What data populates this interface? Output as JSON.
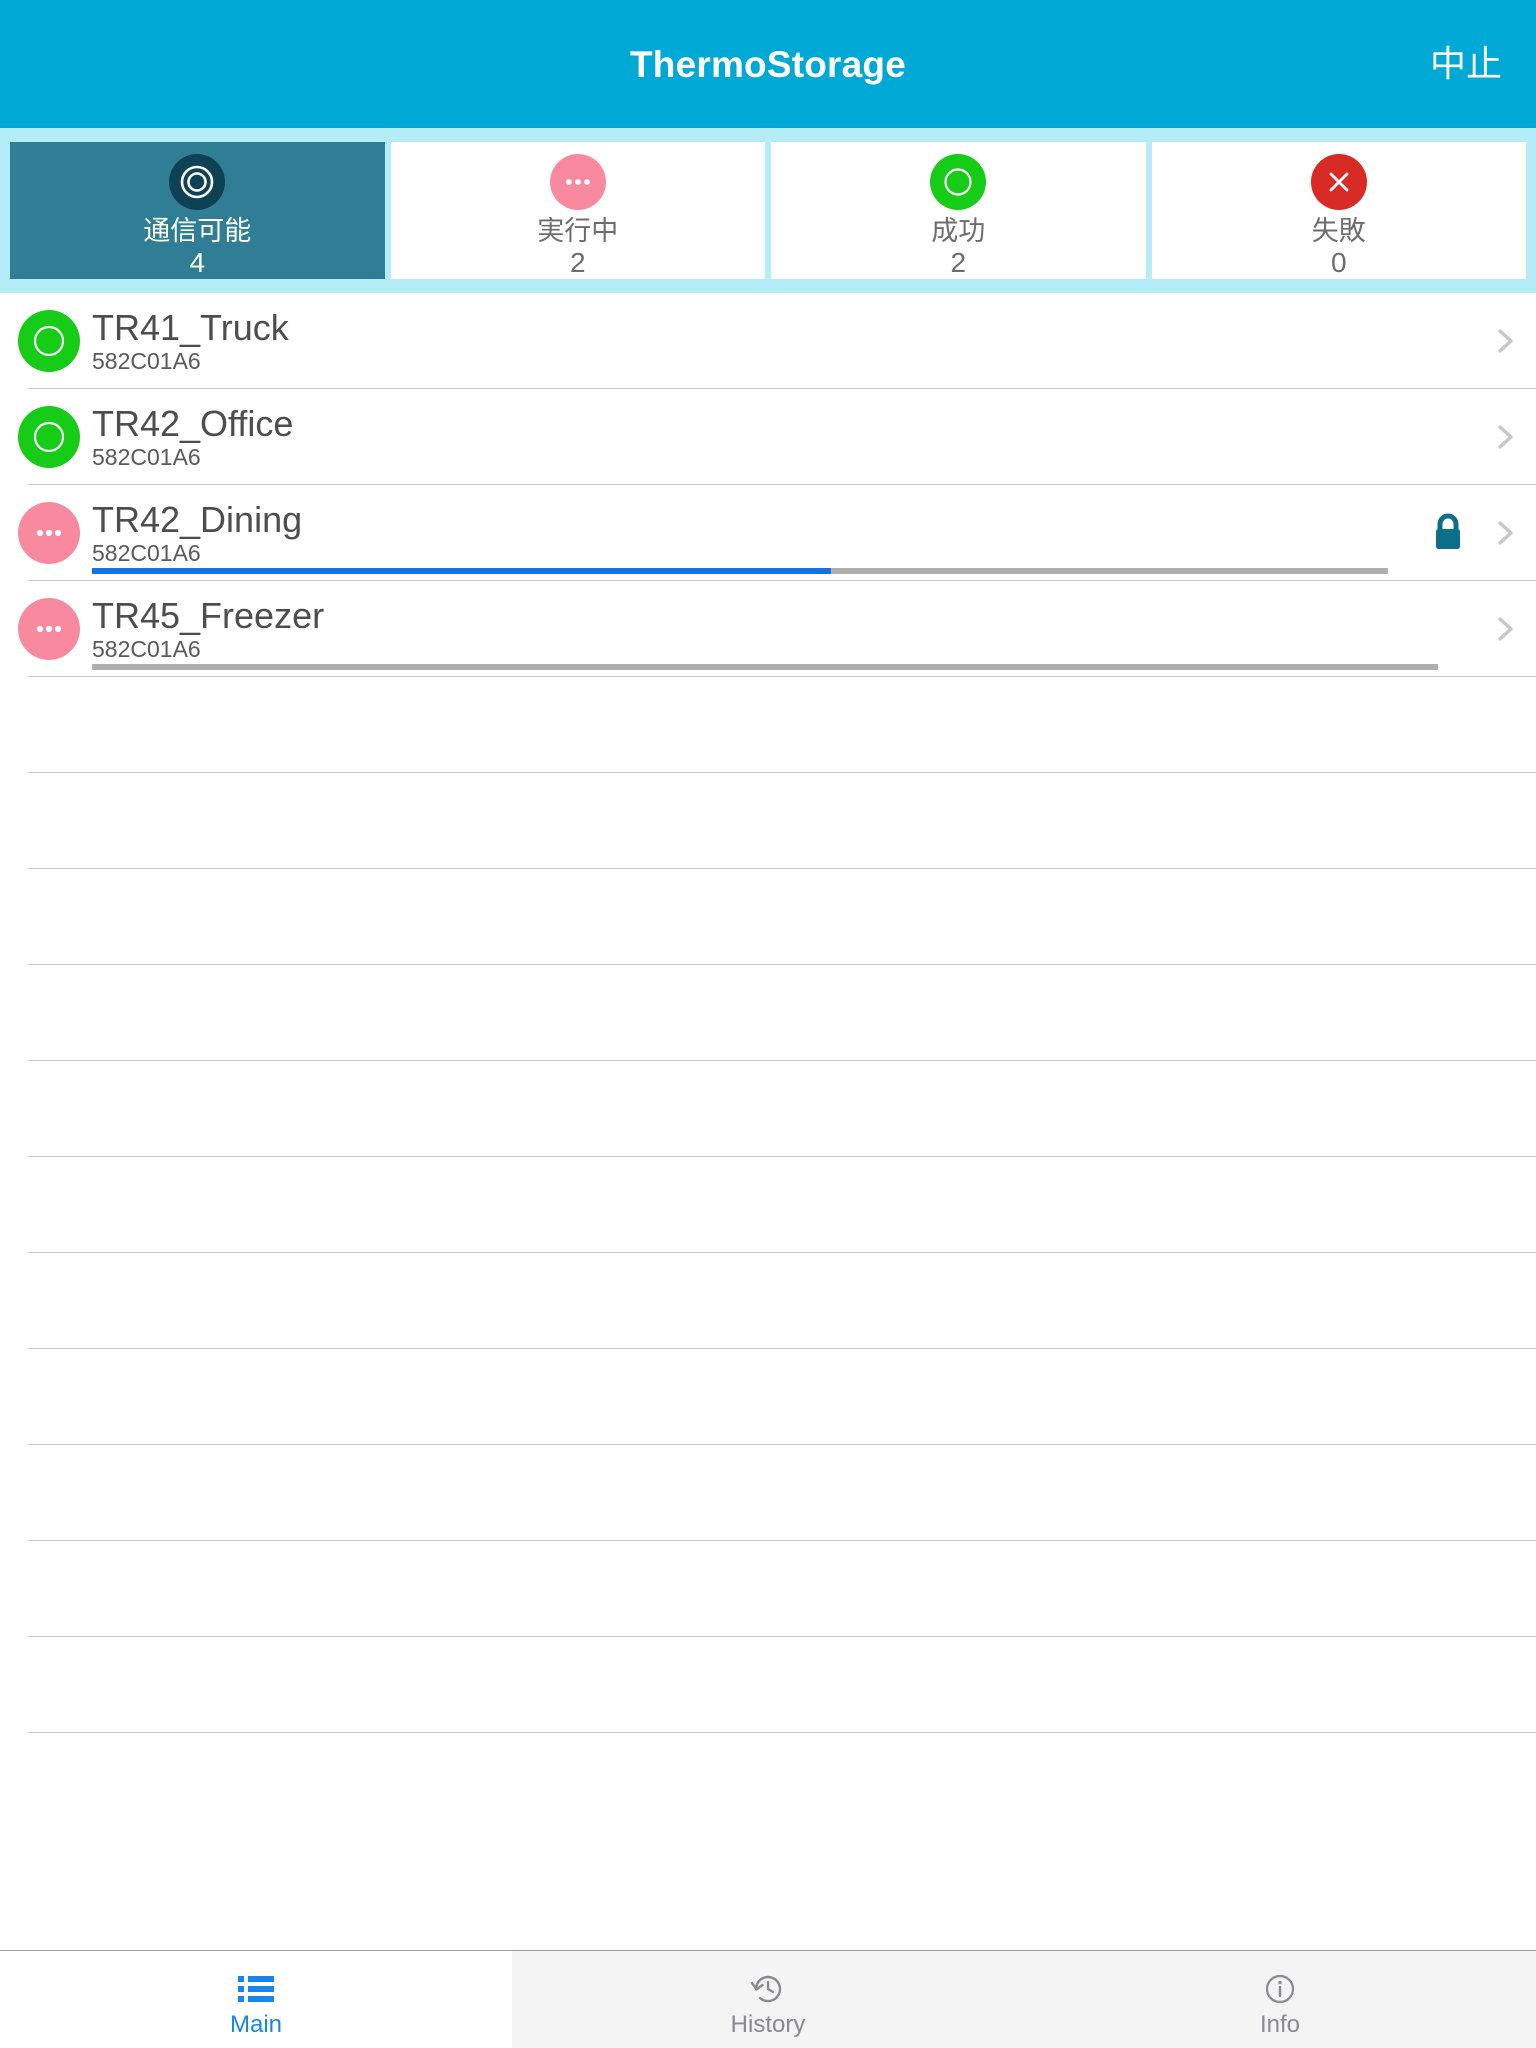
{
  "navbar": {
    "title": "ThermoStorage",
    "action_label": "中止",
    "background": "#00a8d5"
  },
  "status_tabs": {
    "background": "#b4ecf7",
    "items": [
      {
        "icon": "target-circle-icon",
        "label": "通信可能",
        "count": "4",
        "selected": true,
        "icon_color": "#0d4254",
        "selected_bg": "#2f7e95"
      },
      {
        "icon": "ellipsis-circle-icon",
        "label": "実行中",
        "count": "2",
        "selected": false,
        "icon_color": "#f8899f",
        "selected_bg": "#ffffff"
      },
      {
        "icon": "success-circle-icon",
        "label": "成功",
        "count": "2",
        "selected": false,
        "icon_color": "#16cc16",
        "selected_bg": "#ffffff"
      },
      {
        "icon": "failure-cross-icon",
        "label": "失敗",
        "count": "0",
        "selected": false,
        "icon_color": "#d92b26",
        "selected_bg": "#ffffff"
      }
    ]
  },
  "device_list": {
    "rows": [
      {
        "name": "TR41_Truck",
        "id": "582C01A6",
        "status": "success",
        "status_color": "#16cc16",
        "has_progress": false,
        "progress": 0,
        "locked": false
      },
      {
        "name": "TR42_Office",
        "id": "582C01A6",
        "status": "success",
        "status_color": "#16cc16",
        "has_progress": false,
        "progress": 0,
        "locked": false
      },
      {
        "name": "TR42_Dining",
        "id": "582C01A6",
        "status": "running",
        "status_color": "#f8899f",
        "has_progress": true,
        "progress": 57,
        "locked": true
      },
      {
        "name": "TR45_Freezer",
        "id": "582C01A6",
        "status": "running",
        "status_color": "#f8899f",
        "has_progress": true,
        "progress": 0,
        "locked": false
      }
    ],
    "empty_row_count": 11,
    "progress_fill_color": "#1273e6",
    "progress_track_color": "#b0b0b0",
    "lock_color": "#0b6f8c",
    "chevron_color": "#c7c7cc"
  },
  "tabbar": {
    "items": [
      {
        "icon": "list-icon",
        "label": "Main",
        "active": true
      },
      {
        "icon": "clock-icon",
        "label": "History",
        "active": false
      },
      {
        "icon": "info-icon",
        "label": "Info",
        "active": false
      }
    ],
    "active_color": "#1785f0",
    "inactive_color": "#8a8a8e"
  }
}
